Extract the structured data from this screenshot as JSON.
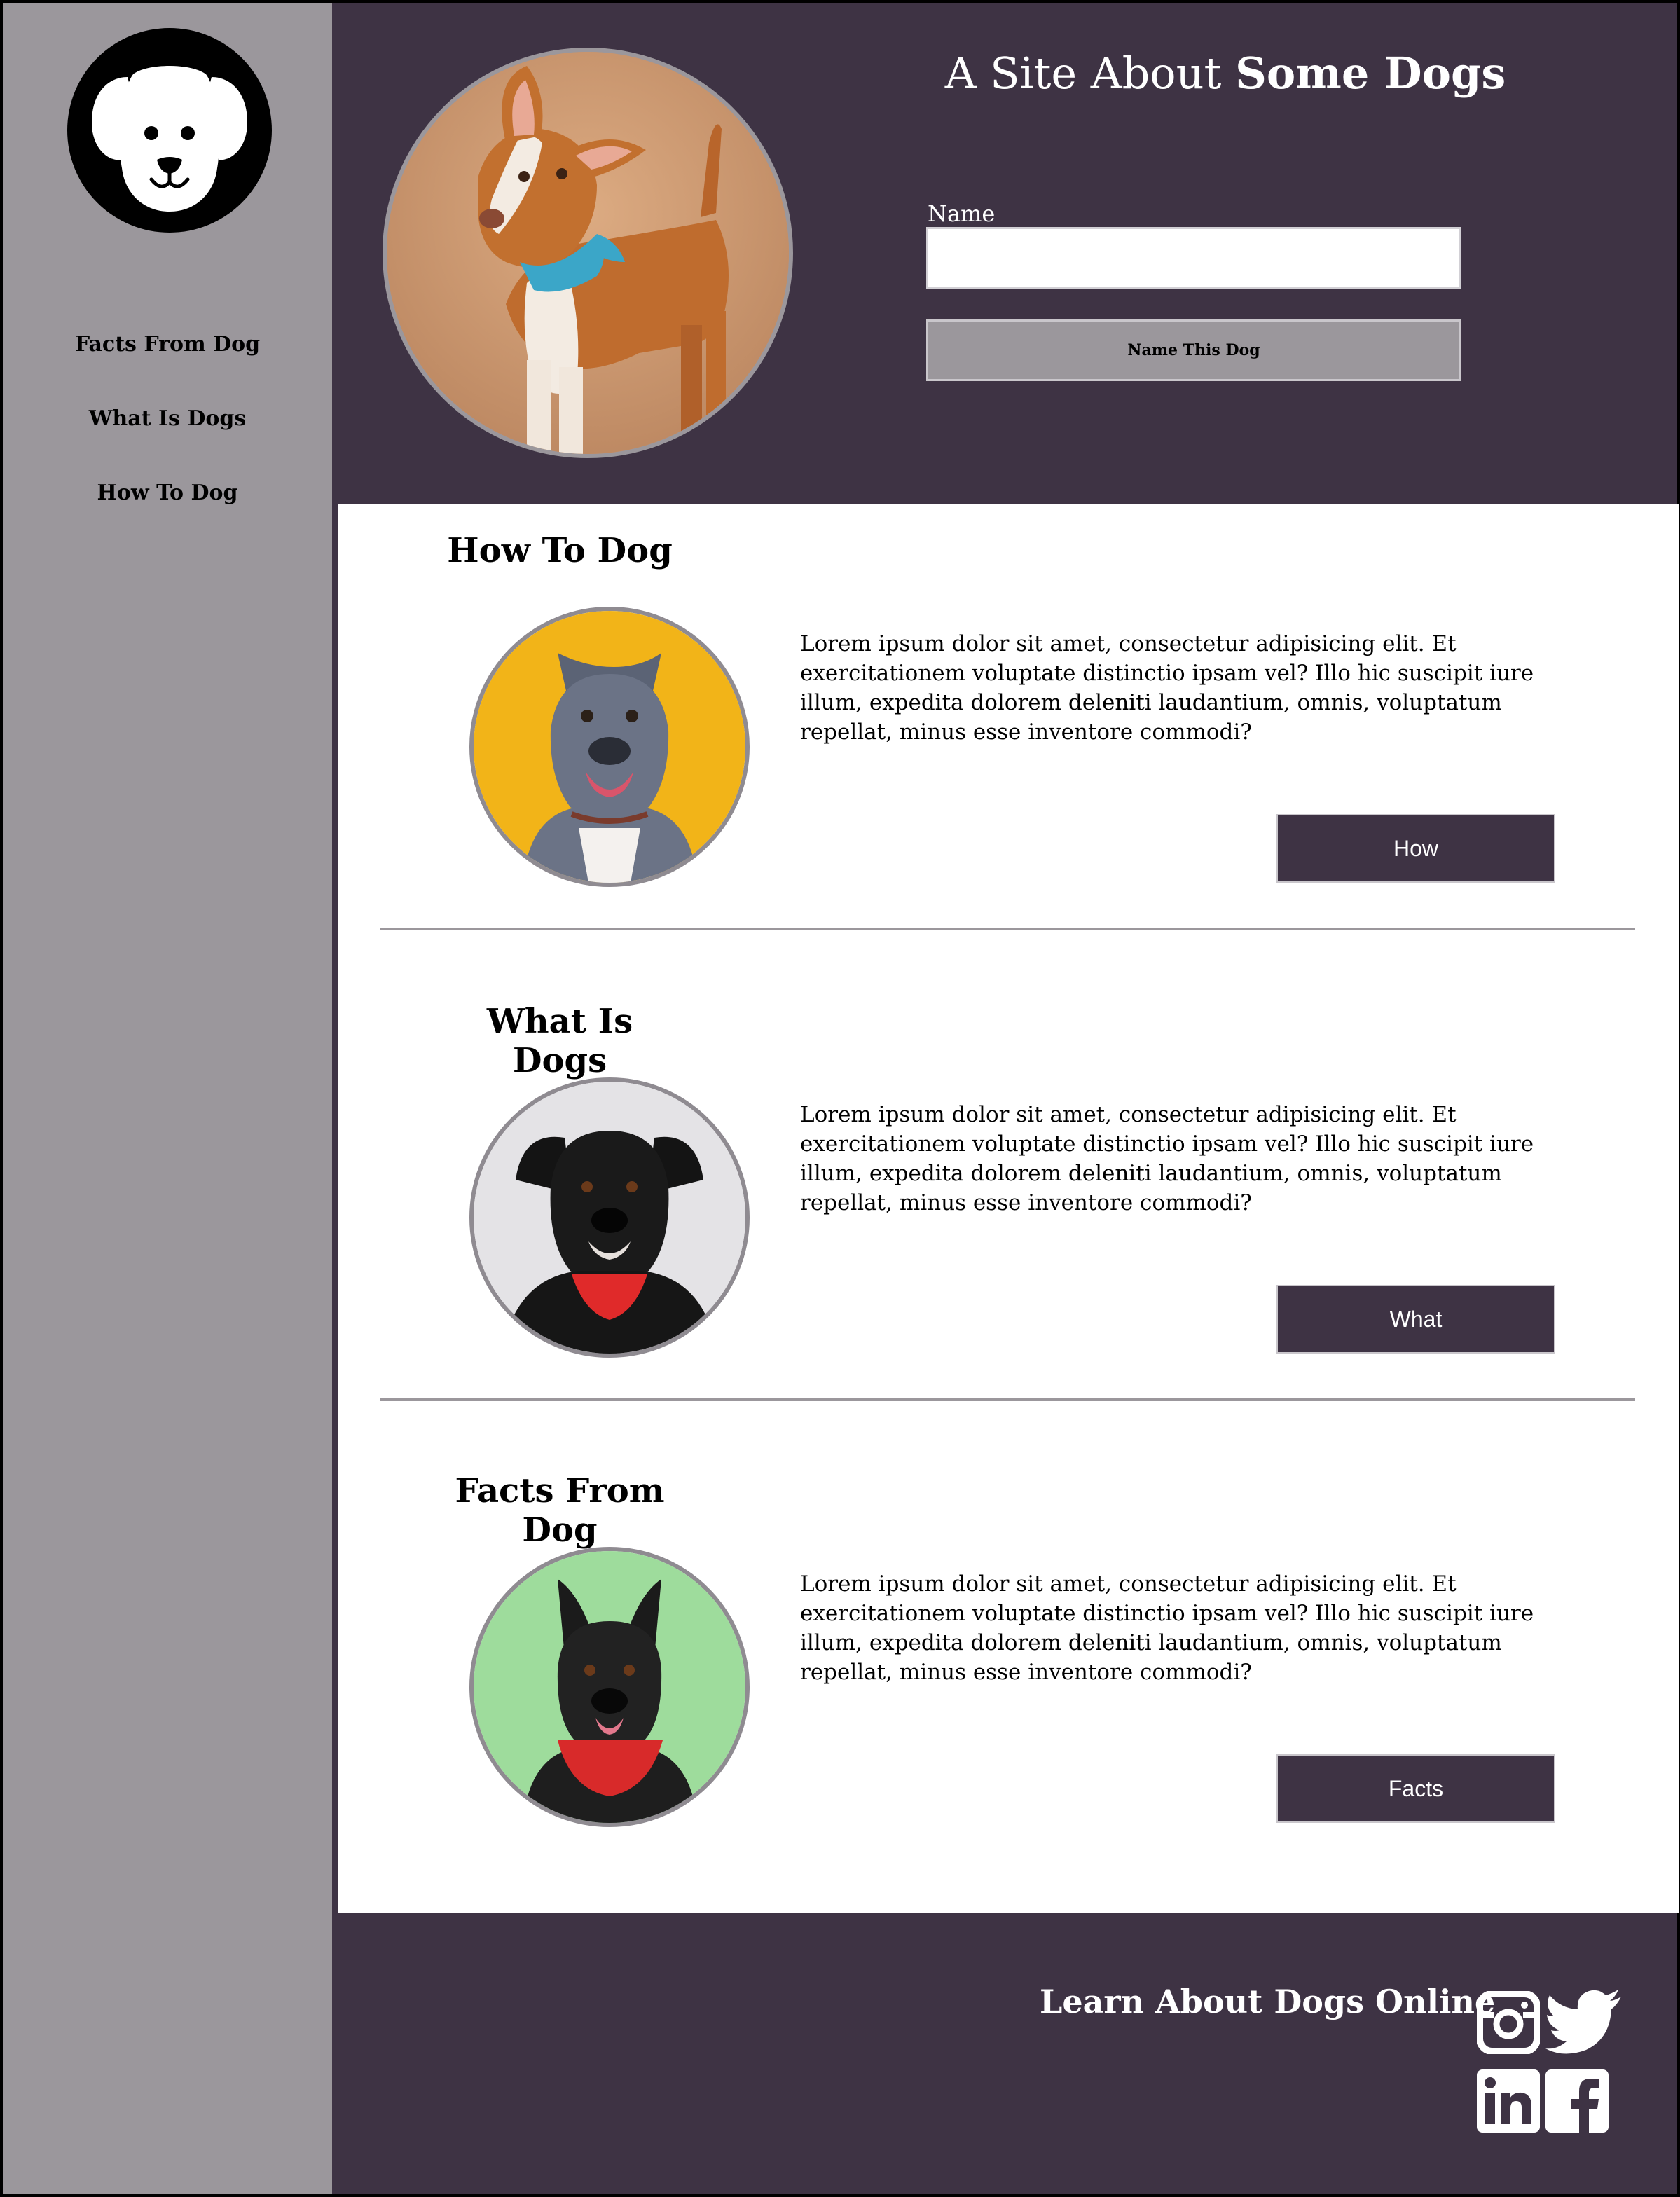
{
  "sidebar": {
    "logo_icon": "dog-face-icon",
    "items": [
      {
        "label": "Facts From Dog"
      },
      {
        "label": "What Is Dogs"
      },
      {
        "label": "How To Dog"
      }
    ]
  },
  "header": {
    "title_prefix": "A Site About ",
    "title_bold": "Some Dogs",
    "name_label": "Name",
    "name_value": "",
    "name_button": "Name This Dog"
  },
  "sections": [
    {
      "title": "How To Dog",
      "text": "Lorem ipsum dolor sit amet, consectetur adipisicing elit. Et exercitationem voluptate distinctio ipsam vel? Illo hic suscipit iure illum, expedita dolorem deleniti laudantium, omnis, voluptatum repellat, minus esse inventore commodi?",
      "button": "How",
      "photo_bg": "#f2b418"
    },
    {
      "title": "What Is Dogs",
      "text": "Lorem ipsum dolor sit amet, consectetur adipisicing elit. Et exercitationem voluptate distinctio ipsam vel? Illo hic suscipit iure illum, expedita dolorem deleniti laudantium, omnis, voluptatum repellat, minus esse inventore commodi?",
      "button": "What",
      "photo_bg": "#e4e3e6"
    },
    {
      "title": "Facts From Dog",
      "text": "Lorem ipsum dolor sit amet, consectetur adipisicing elit. Et exercitationem voluptate distinctio ipsam vel? Illo hic suscipit iure illum, expedita dolorem deleniti laudantium, omnis, voluptatum repellat, minus esse inventore commodi?",
      "button": "Facts",
      "photo_bg": "#9edc9c"
    }
  ],
  "footer": {
    "title": "Learn About Dogs Online",
    "social_icons": [
      "instagram-icon",
      "twitter-icon",
      "linkedin-icon",
      "facebook-icon"
    ]
  },
  "colors": {
    "dark": "#3e3344",
    "sidebar": "#9b979c",
    "white": "#ffffff"
  }
}
